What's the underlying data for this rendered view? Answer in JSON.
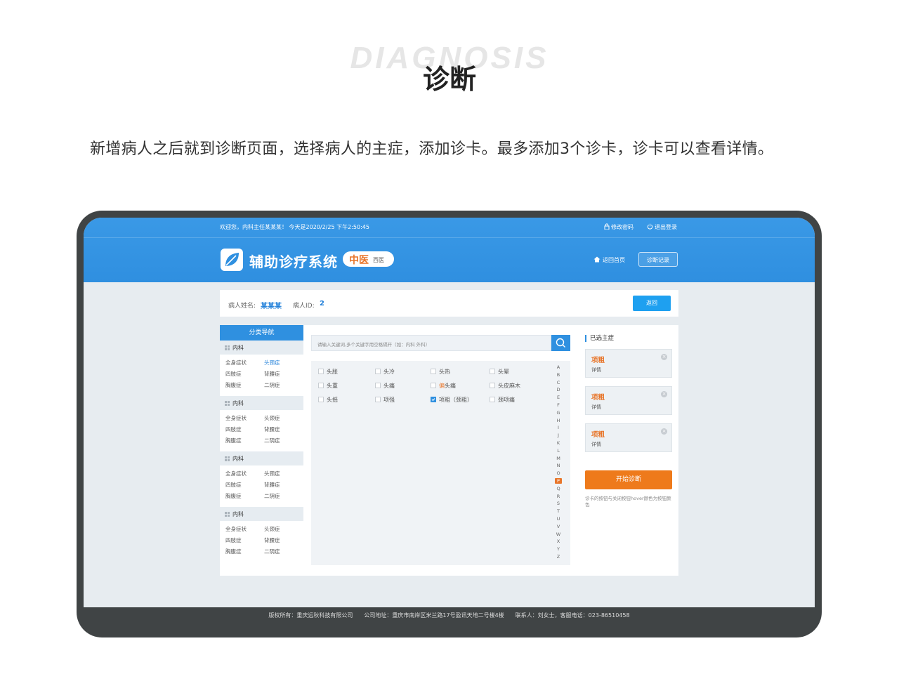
{
  "heading": {
    "bg_title": "DIAGNOSIS",
    "title": "诊断",
    "description": "新增病人之后就到诊断页面，选择病人的主症，添加诊卡。最多添加3个诊卡，诊卡可以查看详情。"
  },
  "topbar": {
    "welcome": "欢迎您，内科主任某某某！ 今天是2020/2/25 下午2:50:45",
    "change_password": "修改密码",
    "logout": "退出登录"
  },
  "header": {
    "system_name": "辅助诊疗系统",
    "mode_active": "中医",
    "mode_inactive": "西医",
    "home_link": "返回首页",
    "records_button": "诊断记录"
  },
  "patient": {
    "name_label": "病人姓名:",
    "name_value": "某某某",
    "id_label": "病人ID:",
    "id_value": "2",
    "back_button": "返回"
  },
  "sidebar": {
    "title": "分类导航",
    "groups": [
      {
        "category": "内科",
        "items": [
          "全身症状",
          "头颈症",
          "四肢症",
          "背腰症",
          "胸腹症",
          "二阴症"
        ]
      },
      {
        "category": "内科",
        "items": [
          "全身症状",
          "头颈症",
          "四肢症",
          "背腰症",
          "胸腹症",
          "二阴症"
        ]
      },
      {
        "category": "内科",
        "items": [
          "全身症状",
          "头颈症",
          "四肢症",
          "背腰症",
          "胸腹症",
          "二阴症"
        ]
      },
      {
        "category": "内科",
        "items": [
          "全身症状",
          "头颈症",
          "四肢症",
          "背腰症",
          "胸腹症",
          "二阴症"
        ]
      }
    ]
  },
  "search": {
    "placeholder": "请输入关键词,多个关键字用空格隔开（如：内科 外科）",
    "icon": "search-icon"
  },
  "symptoms": [
    {
      "label": "头胀",
      "checked": false
    },
    {
      "label": "头冷",
      "checked": false
    },
    {
      "label": "头热",
      "checked": false
    },
    {
      "label": "头晕",
      "checked": false
    },
    {
      "label": "头重",
      "checked": false
    },
    {
      "label": "头痛",
      "checked": false
    },
    {
      "label": "偏头痛",
      "checked": false
    },
    {
      "label": "头皮麻木",
      "checked": false
    },
    {
      "label": "头摇",
      "checked": false
    },
    {
      "label": "项强",
      "checked": false
    },
    {
      "label": "项粗（颈粗）",
      "checked": true
    },
    {
      "label": "颈项痛",
      "checked": false
    }
  ],
  "alphabet": [
    "A",
    "B",
    "C",
    "D",
    "E",
    "F",
    "G",
    "H",
    "I",
    "J",
    "K",
    "L",
    "M",
    "N",
    "O",
    "P",
    "Q",
    "R",
    "S",
    "T",
    "U",
    "V",
    "W",
    "X",
    "Y",
    "Z"
  ],
  "alphabet_active": "P",
  "selected": {
    "title": "已选主症",
    "cards": [
      {
        "name": "项粗",
        "detail": "详情"
      },
      {
        "name": "项粗",
        "detail": "详情"
      },
      {
        "name": "项粗",
        "detail": "详情"
      }
    ],
    "start_button": "开始诊断",
    "note": "诊卡的按钮与关闭按钮hover颜色为按钮颜色"
  },
  "footer": {
    "text": "版权所有：重庆远秋科技有限公司　　公司地址：重庆市南岸区米兰路17号盈讯天地二号楼4楼　　联系人：刘女士，客服电话：023-86510458"
  },
  "colors": {
    "primary": "#2f90e0",
    "accent": "#ee7a1b",
    "device_frame": "#404445"
  }
}
